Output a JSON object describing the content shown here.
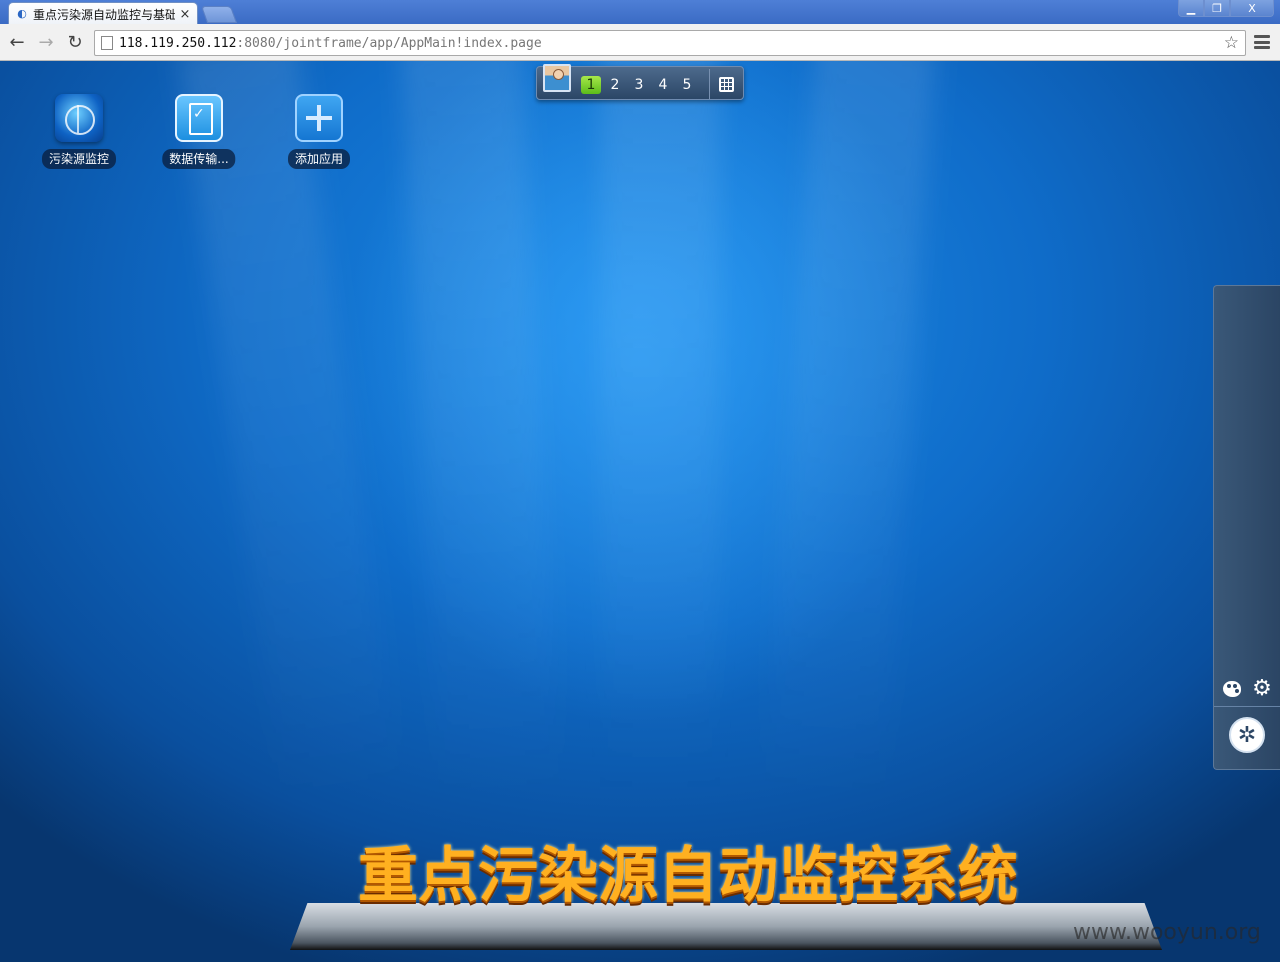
{
  "browser": {
    "tab_title": "重点污染源自动监控与基础",
    "tab_close": "×",
    "url_host": "118.119.250.112",
    "url_rest": ":8080/jointframe/app/AppMain!index.page",
    "window_buttons": {
      "minimize": "▁",
      "restore": "❐",
      "close": "X"
    },
    "nav": {
      "back": "←",
      "forward": "→",
      "reload": "↻"
    },
    "bookmark_star": "☆"
  },
  "pager": {
    "pages": [
      "1",
      "2",
      "3",
      "4",
      "5"
    ],
    "active_page": "1"
  },
  "apps": [
    {
      "label": "污染源监控",
      "icon": "globe-icon"
    },
    {
      "label": "数据传输...",
      "icon": "clipboard-check-icon"
    },
    {
      "label": "添加应用",
      "icon": "add-icon"
    }
  ],
  "dock": {
    "palette_icon": "palette-icon",
    "settings_icon": "⚙",
    "start_icon": "✲"
  },
  "banner": {
    "title": "重点污染源自动监控系统"
  },
  "watermark": "www.wooyun.org"
}
